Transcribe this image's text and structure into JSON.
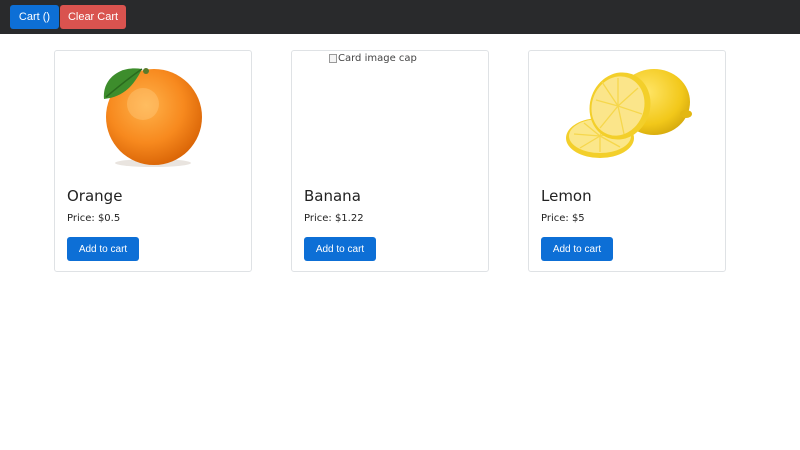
{
  "navbar": {
    "cart_label": "Cart ()",
    "clear_label": "Clear Cart"
  },
  "products": [
    {
      "name": "Orange",
      "price_text": "Price: $0.5",
      "button_label": "Add to cart",
      "image": "orange-image"
    },
    {
      "name": "Banana",
      "price_text": "Price: $1.22",
      "button_label": "Add to cart",
      "image_alt": "Card image cap"
    },
    {
      "name": "Lemon",
      "price_text": "Price: $5",
      "button_label": "Add to cart",
      "image": "lemon-image"
    }
  ],
  "colors": {
    "navbar_bg": "#292a2c",
    "primary": "#0d6fd6",
    "danger": "#d9534f"
  }
}
